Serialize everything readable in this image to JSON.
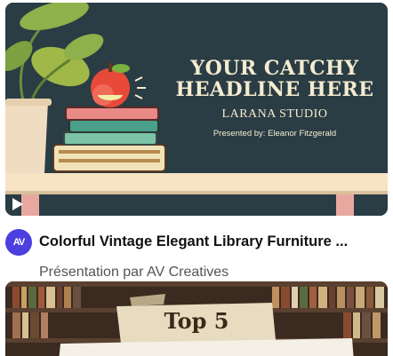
{
  "card1": {
    "headline_line1": "YOUR CATCHY",
    "headline_line2": "HEADLINE HERE",
    "studio": "LARANA STUDIO",
    "presented": "Presented by: Eleanor Fitzgerald",
    "video_icon": "play-icon"
  },
  "template": {
    "avatar_text": "AV",
    "title": "Colorful Vintage Elegant Library Furniture ...",
    "subtitle": "Présentation par AV Creatives"
  },
  "card2": {
    "label": "Top 5"
  },
  "colors": {
    "card_bg": "#2a3c44",
    "headline": "#f4ecd0",
    "avatar": "#4b3fe0"
  }
}
